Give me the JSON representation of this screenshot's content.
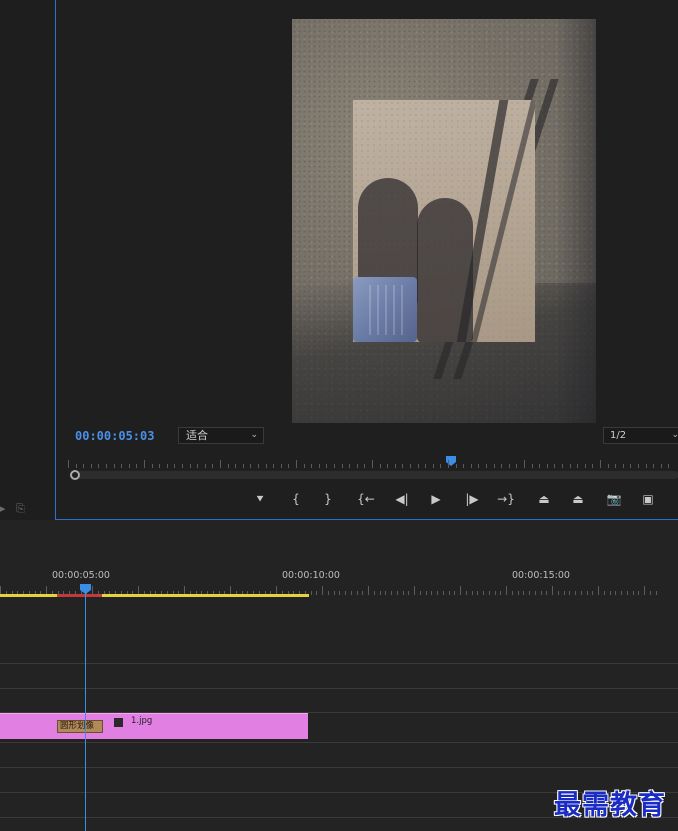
{
  "monitor": {
    "timecode": "00:00:05:03",
    "fit_select": "适合",
    "resolution_select": "1/2"
  },
  "transport": {
    "buttons": [
      {
        "name": "add-marker-button",
        "glyph": "⯆"
      },
      {
        "name": "mark-in-button",
        "glyph": "{"
      },
      {
        "name": "mark-out-button",
        "glyph": "}"
      },
      {
        "name": "go-to-in-button",
        "glyph": "{←"
      },
      {
        "name": "step-back-button",
        "glyph": "◀|"
      },
      {
        "name": "play-button",
        "glyph": "▶"
      },
      {
        "name": "step-forward-button",
        "glyph": "|▶"
      },
      {
        "name": "go-to-out-button",
        "glyph": "→}"
      },
      {
        "name": "lift-button",
        "glyph": "⏏"
      },
      {
        "name": "extract-button",
        "glyph": "⏏"
      },
      {
        "name": "export-frame-button",
        "glyph": "📷"
      },
      {
        "name": "comparison-view-button",
        "glyph": "▣"
      }
    ]
  },
  "timeline": {
    "ruler_labels": [
      "00:00:05:00",
      "00:00:10:00",
      "00:00:15:00"
    ],
    "clip": {
      "effect_label": "圆形划像",
      "name": "1.jpg"
    }
  },
  "watermark": "最需教育"
}
